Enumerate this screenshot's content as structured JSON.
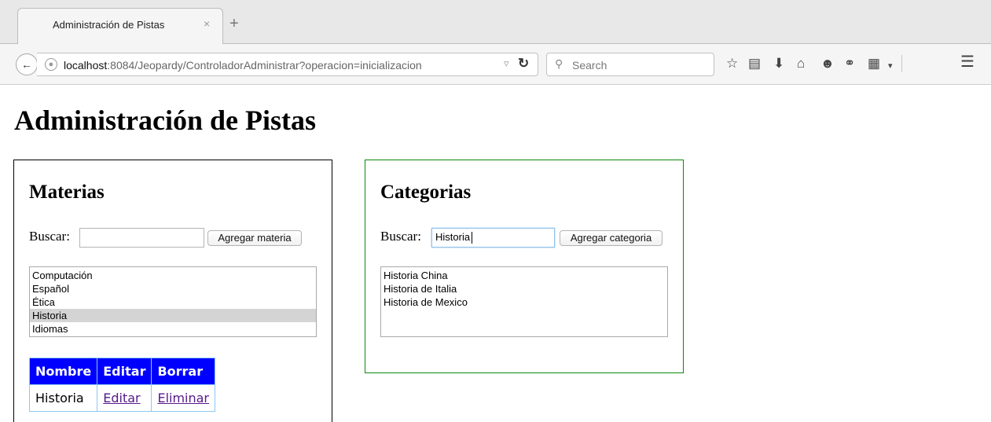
{
  "browser": {
    "tab_title": "Administración de Pistas",
    "tab_close": "×",
    "new_tab": "+",
    "url_host": "localhost",
    "url_rest": ":8084/Jeopardy/ControladorAdministrar?operacion=inicializacion",
    "search_placeholder": "Search",
    "toolbar_icons": [
      "bookmark-star-icon",
      "reading-list-icon",
      "download-icon",
      "home-icon",
      "chat-icon",
      "pocket-icon",
      "clipboard-icon",
      "menu-icon"
    ]
  },
  "page": {
    "title": "Administración de Pistas"
  },
  "materias": {
    "title": "Materias",
    "search_label": "Buscar:",
    "search_value": "",
    "add_button": "Agregar materia",
    "items": [
      "Computación",
      "Español",
      "Ética",
      "Historia",
      "Idiomas"
    ],
    "selected": "Historia",
    "table": {
      "headers": [
        "Nombre",
        "Editar",
        "Borrar"
      ],
      "rows": [
        [
          "Historia",
          "Editar",
          "Eliminar"
        ]
      ]
    }
  },
  "categorias": {
    "title": "Categorias",
    "search_label": "Buscar:",
    "search_value": "Historia",
    "add_button": "Agregar categoria",
    "items": [
      "Historia China",
      "Historia de Italia",
      "Historia de Mexico"
    ]
  },
  "colors": {
    "table_header_bg": "#0000ff",
    "categorias_border": "#0a8a0a",
    "materias_border": "#000000",
    "link_visited": "#551a8b"
  }
}
